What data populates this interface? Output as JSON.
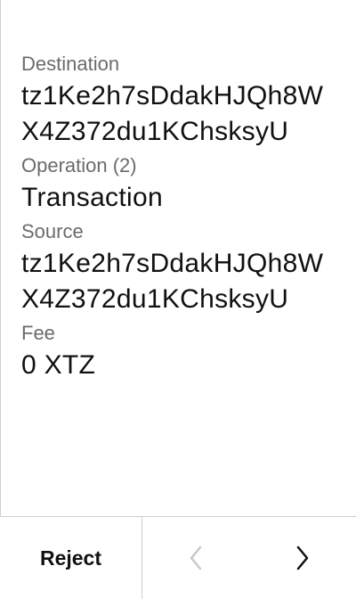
{
  "fields": [
    {
      "label": "Destination",
      "value": "tz1Ke2h7sDdakHJQh8WX4Z372du1KChsksyU"
    },
    {
      "label": "Operation (2)",
      "value": "Transaction"
    },
    {
      "label": "Source",
      "value": "tz1Ke2h7sDdakHJQh8WX4Z372du1KChsksyU"
    },
    {
      "label": "Fee",
      "value": "0 XTZ"
    }
  ],
  "footer": {
    "reject_label": "Reject",
    "prev_icon": "chevron-left-icon",
    "next_icon": "chevron-right-icon"
  },
  "colors": {
    "label": "#6b6b6b",
    "value": "#111111",
    "divider": "#cfcfcf",
    "disabled_icon": "#c8c8c8",
    "active_icon": "#111111"
  }
}
